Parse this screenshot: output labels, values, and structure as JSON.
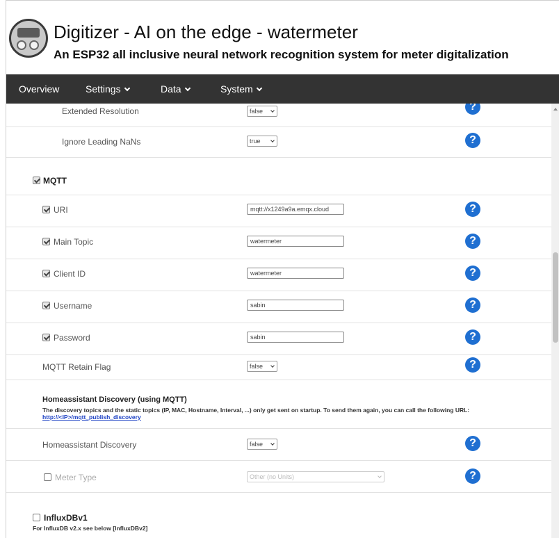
{
  "header": {
    "title": "Digitizer - AI on the edge - watermeter",
    "subtitle": "An ESP32 all inclusive neural network recognition system for meter digitalization"
  },
  "nav": {
    "overview": "Overview",
    "settings": "Settings",
    "data": "Data",
    "system": "System"
  },
  "icons": {
    "help": "question-circle-icon",
    "logo": "watermeter-device-logo"
  },
  "colors": {
    "navbar": "#333333",
    "help_icon": "#1f6fd1",
    "link": "#1a3fc4"
  },
  "rows": {
    "extended_resolution": {
      "label": "Extended Resolution",
      "value": "false"
    },
    "ignore_leading_nans": {
      "label": "Ignore Leading NaNs",
      "value": "true"
    },
    "mqtt": {
      "label": "MQTT",
      "checked": true
    },
    "uri": {
      "label": "URI",
      "value": "mqtt://x1249a9a.emqx.cloud"
    },
    "main_topic": {
      "label": "Main Topic",
      "value": "watermeter"
    },
    "client_id": {
      "label": "Client ID",
      "value": "watermeter"
    },
    "username": {
      "label": "Username",
      "value": "sabin"
    },
    "password": {
      "label": "Password",
      "value": "sabin"
    },
    "retain_flag": {
      "label": "MQTT Retain Flag",
      "value": "false"
    },
    "ha_discovery_section": {
      "title": "Homeassistant Discovery (using MQTT)",
      "description": "The discovery topics and the static topics (IP, MAC, Hostname, Interval, ...) only get sent on startup. To send them again, you can call the following URL:",
      "link": "http://<IP>/mqtt_publish_discovery"
    },
    "ha_discovery": {
      "label": "Homeassistant Discovery",
      "value": "false"
    },
    "meter_type": {
      "label": "Meter Type",
      "value": "Other (no Units)"
    },
    "influxdbv1": {
      "label": "InfluxDBv1",
      "note": "For InfluxDB v2.x see below [InfluxDBv2]"
    }
  }
}
